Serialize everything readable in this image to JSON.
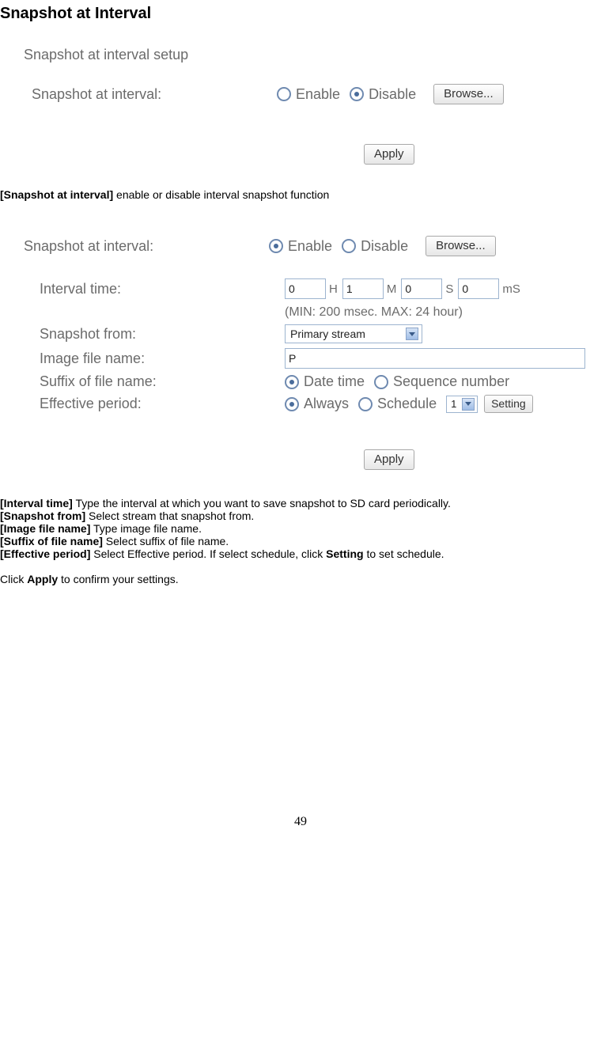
{
  "title": "Snapshot at Interval",
  "panel1": {
    "heading": "Snapshot at interval setup",
    "label": "Snapshot at interval:",
    "enable": "Enable",
    "disable": "Disable",
    "browse": "Browse...",
    "apply": "Apply"
  },
  "desc1_label": "[Snapshot at interval]",
  "desc1_text": " enable or disable interval snapshot function",
  "panel2": {
    "row_snapshot": "Snapshot at interval:",
    "enable": "Enable",
    "disable": "Disable",
    "browse": "Browse...",
    "row_interval": "Interval time:",
    "h_val": "0",
    "h_unit": "H",
    "m_val": "1",
    "m_unit": "M",
    "s_val": "0",
    "s_unit": "S",
    "ms_val": "0",
    "ms_unit": "mS",
    "hint": "(MIN: 200 msec. MAX: 24 hour)",
    "row_from": "Snapshot from:",
    "from_sel": "Primary stream",
    "row_filename": "Image file name:",
    "filename_val": "P",
    "row_suffix": "Suffix of file name:",
    "suffix_dt": "Date time",
    "suffix_seq": "Sequence number",
    "row_effective": "Effective period:",
    "eff_always": "Always",
    "eff_schedule": "Schedule",
    "sched_sel": "1",
    "setting": "Setting",
    "apply": "Apply"
  },
  "def1_l": "[Interval time]",
  "def1_t": " Type the interval at which you want to save snapshot to SD card periodically.",
  "def2_l": "[Snapshot from]",
  "def2_t": " Select stream that snapshot from.",
  "def3_l": "[Image file name]",
  "def3_t": " Type image file name.",
  "def4_l": "[Suffix of file name]",
  "def4_t": " Select suffix of file name.",
  "def5_l": "[Effective period]",
  "def5_t_a": " Select Effective period. If select schedule, click ",
  "def5_t_b": "Setting",
  "def5_t_c": " to set schedule.",
  "conf_a": "Click ",
  "conf_b": "Apply",
  "conf_c": " to confirm your settings.",
  "page_num": "49"
}
